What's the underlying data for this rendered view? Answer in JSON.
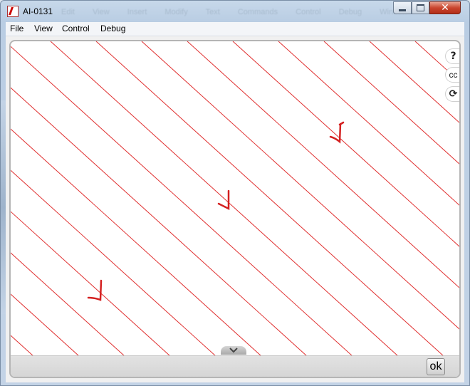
{
  "window": {
    "title": "AI-0131",
    "ghost_menu": [
      "Edit",
      "View",
      "Insert",
      "Modify",
      "Text",
      "Commands",
      "Control",
      "Debug",
      "Window"
    ],
    "close_glyph": "✕"
  },
  "menubar": {
    "file": "File",
    "view": "View",
    "control": "Control",
    "debug": "Debug"
  },
  "stage": {
    "help_label": "?",
    "cc_label": "cc",
    "refresh_glyph": "⟳",
    "ok_label": "ok",
    "hatch_color": "#e03030",
    "arrow_color": "#d42020"
  }
}
